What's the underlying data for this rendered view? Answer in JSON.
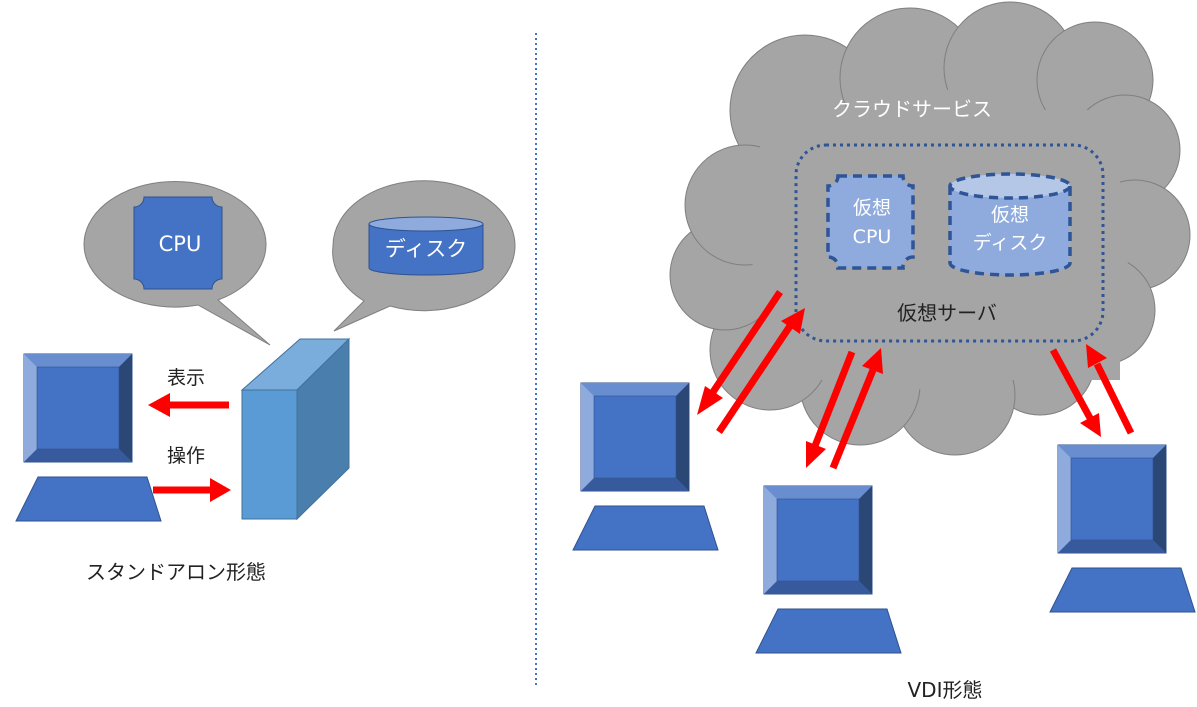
{
  "standalone": {
    "caption": "スタンドアロン形態",
    "cpu_label": "CPU",
    "disk_label": "ディスク",
    "display_label": "表示",
    "operation_label": "操作"
  },
  "vdi": {
    "caption": "VDI形態",
    "cloud_label": "クラウドサービス",
    "virtual_server_label": "仮想サーバ",
    "virtual_cpu_label_line1": "仮想",
    "virtual_cpu_label_line2": "CPU",
    "virtual_disk_label_line1": "仮想",
    "virtual_disk_label_line2": "ディスク",
    "client_count": 3
  },
  "colors": {
    "shape_blue": "#4472c4",
    "cloud_gray": "#a5a5a5",
    "arrow_red": "#ff0000",
    "virtual_fill": "#8faadc",
    "dash_border": "#2f5597",
    "server_front": "#5b9bd5",
    "server_top": "#7aaddc",
    "server_side": "#4a7ead"
  }
}
